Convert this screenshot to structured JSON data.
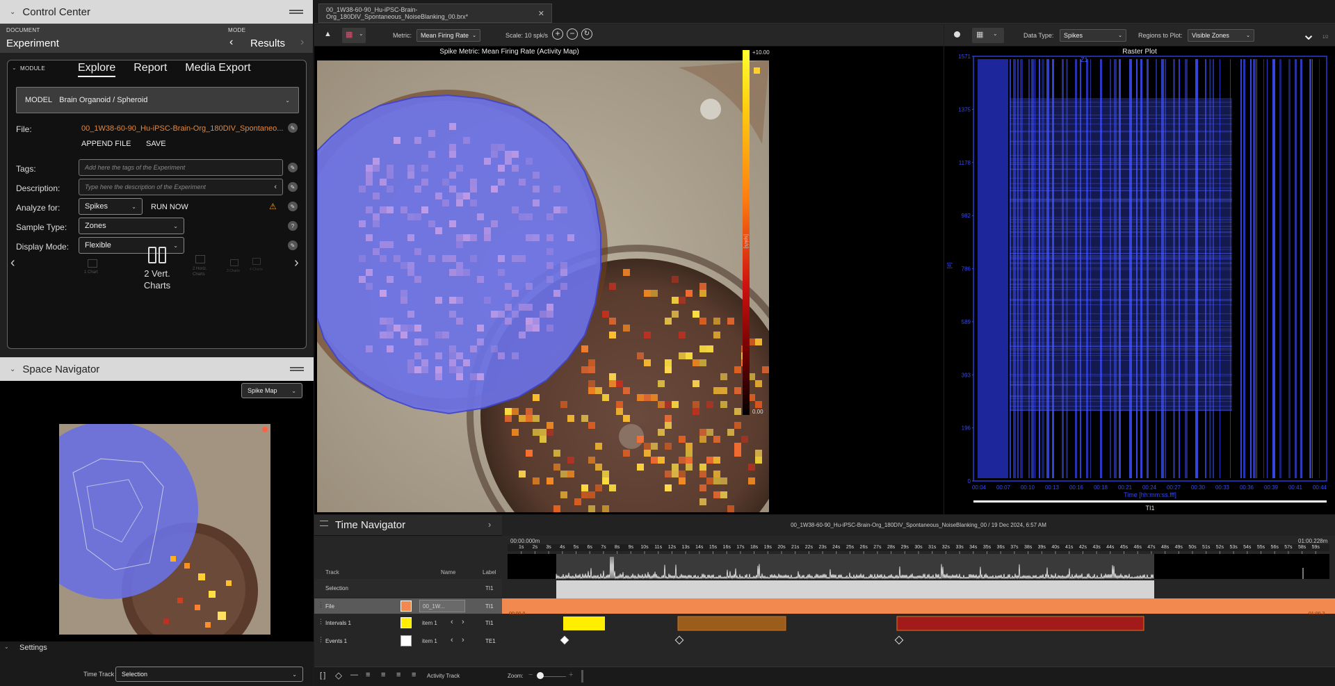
{
  "control_center": {
    "title": "Control Center",
    "document_label": "DOCUMENT",
    "document_value": "Experiment",
    "mode_label": "MODE",
    "mode_value": "Results",
    "module_label": "MODULE",
    "tabs": [
      "Explore",
      "Report",
      "Media Export"
    ],
    "model_label": "MODEL",
    "model_value": "Brain Organoid / Spheroid",
    "file_label": "File:",
    "file_value": "00_1W38-60-90_Hu-iPSC-Brain-Org_180DIV_Spontaneo...",
    "append_file": "APPEND FILE",
    "save": "SAVE",
    "tags_label": "Tags:",
    "tags_placeholder": "Add here the tags of the Experiment",
    "description_label": "Description:",
    "description_placeholder": "Type here the description of the Experiment",
    "analyze_label": "Analyze for:",
    "analyze_value": "Spikes",
    "run_now": "RUN NOW",
    "sample_type_label": "Sample Type:",
    "sample_type_value": "Zones",
    "display_mode_label": "Display Mode:",
    "display_mode_value": "Flexible",
    "layouts": [
      "1 Chart",
      "2 Vert. Charts",
      "2 Horiz. Charts",
      "3 Charts",
      "4 Charts"
    ],
    "selected_layout": "2 Vert.\nCharts"
  },
  "space_navigator": {
    "title": "Space Navigator",
    "map_select": "Spike Map",
    "settings_label": "Settings",
    "time_track_label": "Time Track",
    "time_track_value": "Selection"
  },
  "file_tab": "00_1W38-60-90_Hu-iPSC-Brain-Org_180DIV_Spontaneous_NoiseBlanking_00.brx*",
  "center_toolbar": {
    "metric_label": "Metric:",
    "metric_value": "Mean Firing Rate",
    "scale_label": "Scale: 10 spk/s"
  },
  "map": {
    "title": "Spike Metric: Mean Firing Rate (Activity Map)",
    "colorbar_max": "+10.00",
    "colorbar_min": "0.00",
    "colorbar_unit": "[spk/s]"
  },
  "right_toolbar": {
    "data_type_label": "Data Type:",
    "data_type_value": "Spikes",
    "regions_label": "Regions to Plot:",
    "regions_value": "Visible Zones",
    "page_indicator": "1/2"
  },
  "chart_data": {
    "type": "scatter",
    "title": "Raster Plot",
    "series": [
      {
        "name": "Z1",
        "values": []
      }
    ],
    "xlabel": "Time [hh:mm:ss.fff]",
    "ylabel": "[#]",
    "xticks": [
      "00:04",
      "00:07",
      "00:10",
      "00:13",
      "00:16",
      "00:18",
      "00:21",
      "00:24",
      "00:27",
      "00:30",
      "00:33",
      "00:36",
      "00:39",
      "00:41",
      "00:44"
    ],
    "yticks": [
      "0",
      "196",
      "393",
      "589",
      "786",
      "982",
      "1178",
      "1375",
      "1571"
    ],
    "ylim": [
      0,
      1571
    ],
    "footer_label": "TI1"
  },
  "time_navigator": {
    "title": "Time Navigator",
    "header_info": "00_1W38-60-90_Hu-iPSC-Brain-Org_180DIV_Spontaneous_NoiseBlanking_00 / 19 Dec 2024, 6:57 AM",
    "start_time": "00:00.000m",
    "end_time": "01:00.228m",
    "col_track": "Track",
    "col_name": "Name",
    "col_label": "Label",
    "selection_row": {
      "track": "Selection",
      "label": "TI1"
    },
    "file_row": {
      "track": "File",
      "name": "00_1W...",
      "label": "TI1",
      "color": "#f28a50",
      "start": "00:00.0",
      "end": "01:00.2"
    },
    "intervals_row": {
      "track": "Intervals 1",
      "name": "item 1",
      "label": "TI1",
      "color": "#ffee00"
    },
    "events_row": {
      "track": "Events 1",
      "name": "item 1",
      "label": "TE1",
      "color": "#ffffff"
    },
    "seconds": [
      "1s",
      "2s",
      "3s",
      "4s",
      "5s",
      "6s",
      "7s",
      "8s",
      "9s",
      "10s",
      "11s",
      "12s",
      "13s",
      "14s",
      "15s",
      "16s",
      "17s",
      "18s",
      "19s",
      "20s",
      "21s",
      "22s",
      "23s",
      "24s",
      "25s",
      "26s",
      "27s",
      "28s",
      "29s",
      "30s",
      "31s",
      "32s",
      "33s",
      "34s",
      "35s",
      "36s",
      "37s",
      "38s",
      "39s",
      "40s",
      "41s",
      "42s",
      "43s",
      "44s",
      "45s",
      "46s",
      "47s",
      "48s",
      "49s",
      "50s",
      "51s",
      "52s",
      "53s",
      "54s",
      "55s",
      "56s",
      "57s",
      "58s",
      "59s"
    ],
    "activity_track_label": "Activity Track",
    "zoom_label": "Zoom:"
  }
}
